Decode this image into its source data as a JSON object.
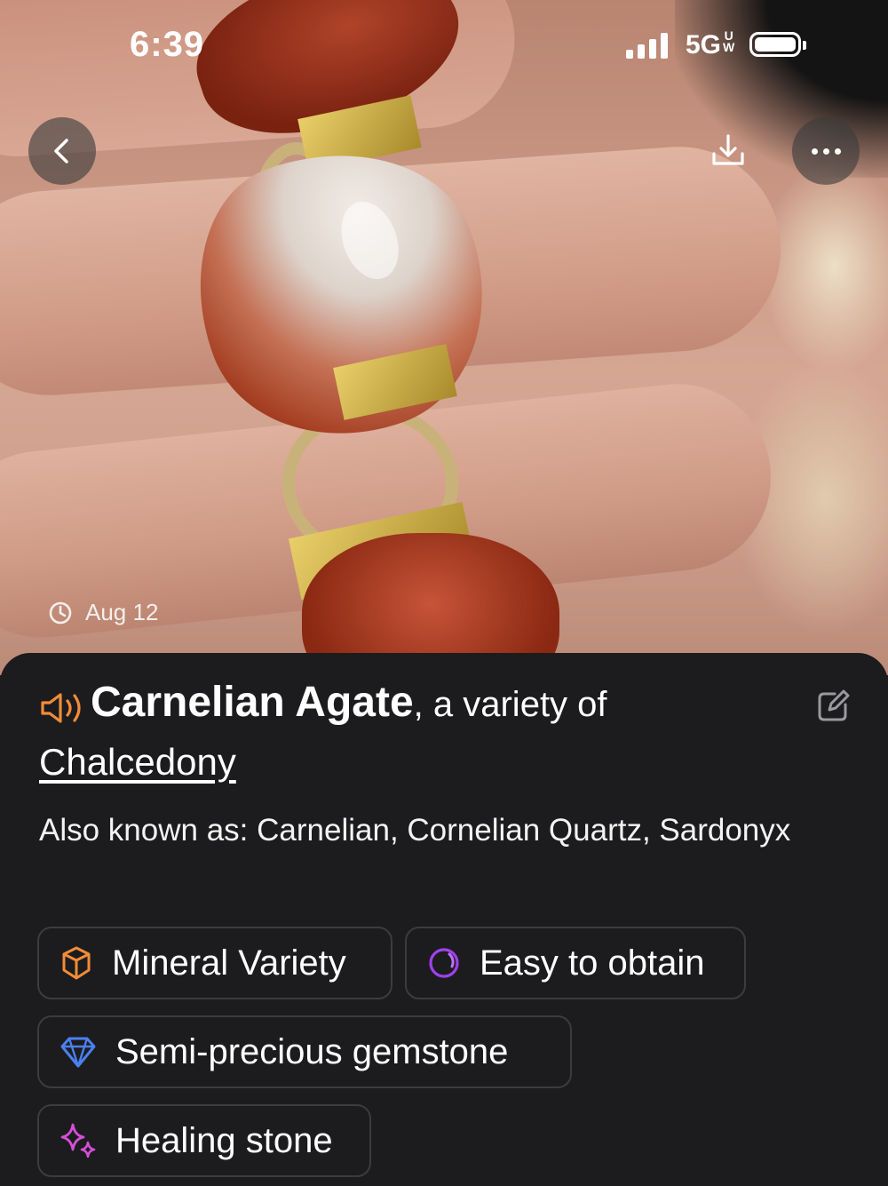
{
  "status_bar": {
    "time": "6:39",
    "network": "5G",
    "network_suffix": "UW"
  },
  "photo": {
    "date": "Aug 12"
  },
  "specimen": {
    "name": "Carnelian Agate",
    "variety_text": ", a variety of",
    "parent": "Chalcedony",
    "aka_label": "Also known as:",
    "aka_values": "Carnelian, Cornelian Quartz, Sardonyx"
  },
  "tags": [
    {
      "label": "Mineral Variety",
      "icon": "crystal-icon",
      "color": "#f28c38"
    },
    {
      "label": "Easy to obtain",
      "icon": "rarity-ring-icon",
      "color": "#a040f0"
    },
    {
      "label": "Semi-precious gemstone",
      "icon": "diamond-icon",
      "color": "#4a80f0"
    },
    {
      "label": "Healing stone",
      "icon": "sparkle-icon",
      "color": "#d64fd6"
    }
  ],
  "colors": {
    "speaker": "#f28c38",
    "sheet_bg": "#1c1c1e",
    "chip_border": "#3c3c3f"
  }
}
